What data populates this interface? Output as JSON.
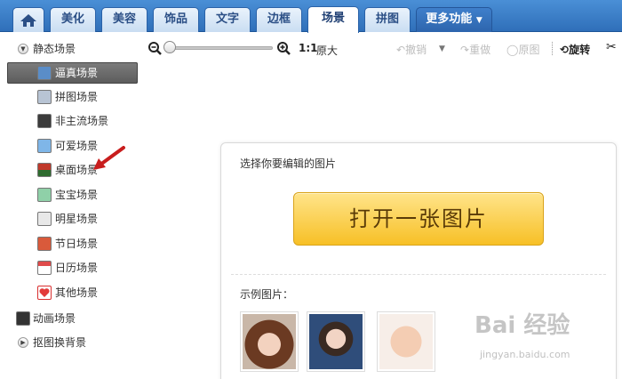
{
  "tabs": {
    "home_icon": "home-icon",
    "items": [
      "美化",
      "美容",
      "饰品",
      "文字",
      "边框",
      "场景",
      "拼图",
      "更多功能"
    ],
    "active": "场景"
  },
  "sidebar": {
    "static_group": "静态场景",
    "items": [
      "逼真场景",
      "拼图场景",
      "非主流场景",
      "可爱场景",
      "桌面场景",
      "宝宝场景",
      "明星场景",
      "节日场景",
      "日历场景",
      "其他场景"
    ],
    "selected": "逼真场景",
    "animated_group": "动画场景",
    "cutout_group": "抠图换背景"
  },
  "toolbar": {
    "ratio": "1:1",
    "original_size": "原大",
    "undo": "撤销",
    "redo": "重做",
    "original": "原图",
    "rotate": "旋转"
  },
  "main": {
    "choose_title": "选择你要编辑的图片",
    "open_button": "打开一张图片",
    "example_title": "示例图片："
  },
  "watermark": {
    "brand": "Bai 经验",
    "url": "jingyan.baidu.com"
  },
  "colors": {
    "tab_bar": "#2f6fb9",
    "open_button": "#f7c026",
    "selected_item": "#6b6b6b"
  }
}
